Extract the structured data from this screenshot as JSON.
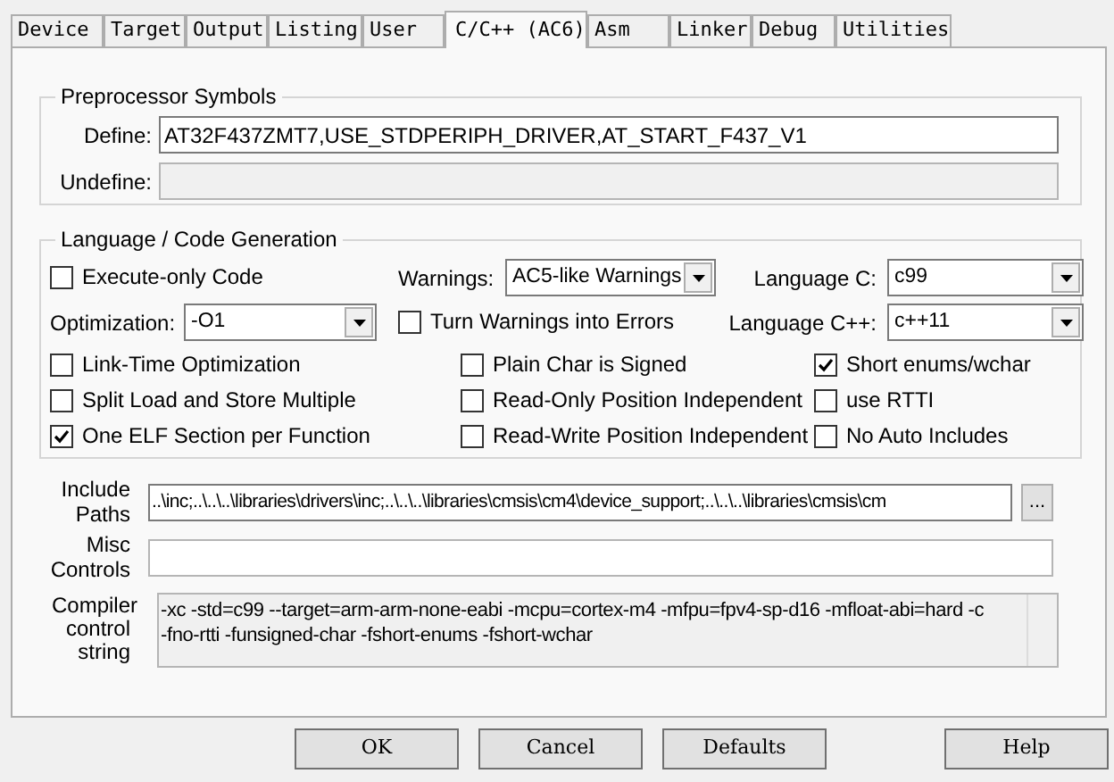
{
  "tabs": [
    {
      "label": "Device",
      "selected": false
    },
    {
      "label": "Target",
      "selected": false
    },
    {
      "label": "Output",
      "selected": false
    },
    {
      "label": "Listing",
      "selected": false
    },
    {
      "label": "User",
      "selected": false
    },
    {
      "label": "C/C++ (AC6)",
      "selected": true
    },
    {
      "label": "Asm",
      "selected": false
    },
    {
      "label": "Linker",
      "selected": false
    },
    {
      "label": "Debug",
      "selected": false
    },
    {
      "label": "Utilities",
      "selected": false
    }
  ],
  "preprocessor": {
    "title": "Preprocessor Symbols",
    "fields": [
      {
        "label": "Define:",
        "value": "AT32F437ZMT7,USE_STDPERIPH_DRIVER,AT_START_F437_V1",
        "disabled": false
      },
      {
        "label": "Undefine:",
        "disabled": true
      }
    ]
  },
  "language": {
    "title": "Language / Code Generation",
    "rows": [
      [
        {
          "kind": "checkbox",
          "label": "Execute-only Code",
          "checked": false
        },
        {
          "kind": "select",
          "label": "Warnings:",
          "value": "AC5-like Warnings"
        },
        {
          "kind": "select",
          "label": "Language C:",
          "value": "c99"
        }
      ],
      [
        {
          "kind": "select",
          "label": "Optimization:",
          "value": "-O1"
        },
        {
          "kind": "checkbox",
          "label": "Turn Warnings into Errors",
          "checked": false
        },
        {
          "kind": "select",
          "label": "Language C++:",
          "value": "c++11"
        }
      ]
    ],
    "options": [
      [
        {
          "label": "Link-Time Optimization",
          "checked": false
        },
        {
          "label": "Plain Char is Signed",
          "checked": false
        },
        {
          "label": "Short enums/wchar",
          "checked": true
        }
      ],
      [
        {
          "label": "Split Load and Store Multiple",
          "checked": false
        },
        {
          "label": "Read-Only Position Independent",
          "checked": false
        },
        {
          "label": "use RTTI",
          "checked": false
        }
      ],
      [
        {
          "label": "One ELF Section per Function",
          "checked": true
        },
        {
          "label": "Read-Write Position Independent",
          "checked": false
        },
        {
          "label": "No Auto Includes",
          "checked": false
        }
      ]
    ]
  },
  "include_paths": {
    "label": "Include Paths",
    "value": "..\\inc;..\\..\\..\\libraries\\drivers\\inc;..\\..\\..\\libraries\\cmsis\\cm4\\device_support;..\\..\\..\\libraries\\cmsis\\cm",
    "browse": "..."
  },
  "misc_controls": {
    "label": "Misc Controls"
  },
  "compiler_string": {
    "label": "Compiler control string",
    "value": "-xc -std=c99 --target=arm-arm-none-eabi -mcpu=cortex-m4 -mfpu=fpv4-sp-d16 -mfloat-abi=hard -c\n-fno-rtti -funsigned-char -fshort-enums -fshort-wchar"
  },
  "buttons": [
    "OK",
    "Cancel",
    "Defaults",
    "Help"
  ]
}
